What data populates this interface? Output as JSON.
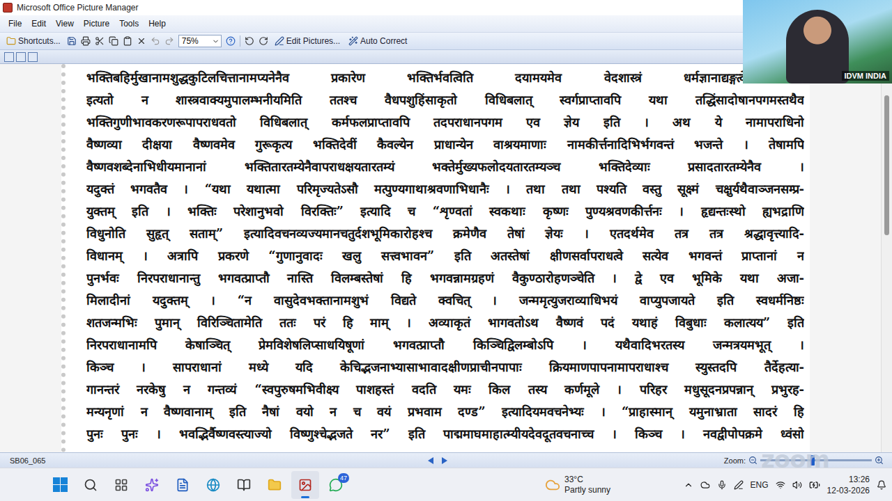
{
  "window": {
    "title": "Microsoft Office Picture Manager"
  },
  "menu": [
    "File",
    "Edit",
    "View",
    "Picture",
    "Tools",
    "Help"
  ],
  "toolbar": {
    "shortcuts": "Shortcuts...",
    "zoom": "75%",
    "edit": "Edit Pictures...",
    "autocorrect": "Auto Correct"
  },
  "document": {
    "lines": [
      "भक्तिबहिर्मुखानामशुद्धकुटिलचित्तानामप्यनेनैव प्रकारेण भक्तिर्भवत्विति दयामयमेव वेदशास्त्रं धर्मज्ञानाद्यङ्गत्वेन भ",
      "इत्यतो न शास्त्रवाक्यमुपालम्भनीयमिति ततश्च वैधपशुहिंसाकृतो विधिबलात् स्वर्गप्राप्तावपि यथा तद्धिंसादोषानपगमस्तथैव",
      "भक्तिगुणीभावकरणरूपापराधवतो विधिबलात् कर्मफलप्राप्तावपि तदपराधानपगम एव ज्ञेय इति । अथ ये नामापराधिनो",
      "वैष्णव्या दीक्षया वैष्णवमेव गुरूकृत्य भक्तिदेवीं कैवल्येन प्राधान्येन वाश्रयमाणाः नामकीर्त्तनादिभिर्भगवन्तं भजन्ते । तेषामपि",
      "वैष्णवशब्देनाभिधीयमानानां भक्तितारतम्येनैवापराधक्षयतारतम्यं भक्तेर्मुख्यफलोदयतारतम्यञ्च भक्तिदेव्याः प्रसादतारतम्येनैव ।",
      "यदुक्तं भगवतैव । “यथा यथात्मा परिमृज्यतेऽसौ मत्पुण्यगाथाश्रवणाभिधानैः । तथा तथा पश्यति वस्तु सूक्ष्मं चक्षुर्यथैवाञ्जनसम्प्र-",
      "युक्तम् इति । भक्तिः परेशानुभवो विरक्तिः” इत्यादि च “शृण्वतां स्वकथाः कृष्णः पुण्यश्रवणकीर्त्तनः । हृद्यन्तःस्थो ह्यभद्राणि",
      "विधुनोति सुहृत् सताम्” इत्यादिवचनव्यज्यमानचतुर्दशभूमिकारोहश्च क्रमेणैव तेषां ज्ञेयः । एतदर्थमेव तत्र तत्र श्रद्धावृत्त्यादि-",
      "विधानम् । अत्रापि प्रकरणे “गुणानुवादः खलु सत्त्वभावन” इति अतस्तेषां क्षीणसर्वापराधत्वे सत्येव भगवन्तं प्राप्तानां न",
      "पुनर्भवः निरपराधानान्तु भगवत्प्राप्तौ नास्ति विलम्बस्तेषां हि भगवन्नामग्रहणं वैकुण्ठारोहणञ्चेति । द्वे एव भूमिके यथा अजा-",
      "मिलादीनां यदुक्तम् । “न वासुदेवभक्तानामशुभं विद्यते क्वचित् । जन्ममृत्युजराव्याधिभयं वाप्युपजायते इति स्वधर्मनिष्ठः",
      "शतजन्मभिः पुमान् विरिञ्चितामेति ततः परं हि माम् । अव्याकृतं भागवतोऽथ वैष्णवं पदं यथाहं विबुधाः कलात्यय” इति",
      "निरपराधानामपि केषाञ्चित् प्रेमविशेषलिप्साधयिषूणां भगवत्प्राप्तौ किञ्चिद्विलम्बोऽपि । यथैवादिभरतस्य जन्मत्रयमभूत् ।",
      "किञ्च । सापराधानां मध्ये यदि केचिद्भजनाभ्यासाभावादक्षीणप्राचीनपापाः क्रियमाणपापनामापराधाश्च स्युस्तदपि तैर्देहत्या-",
      "गानन्तरं नरकेषु न गन्तव्यं “स्वपुरुषमभिवीक्ष्य पाशहस्तं वदति यमः किल तस्य कर्णमूले । परिहर मधुसूदनप्रपन्नान् प्रभुरह-",
      "मन्यनृणां न वैष्णवानाम् इति नैषां वयो न च वयं प्रभवाम दण्ड” इत्यादियमवचनेभ्यः । “प्राहास्मान् यमुनाभ्राता सादरं हि",
      "पुनः पुनः । भवद्भिर्वैष्णवस्त्याज्यो विष्णुश्चेद्भजते नर” इति पाद्ममाघमाहात्म्यीयदेवदूतवचनाच्च । किञ्च । नवद्वीपोपक्रमे ध्वंसो"
    ]
  },
  "scrollbar": {
    "position": 0.08,
    "size": 0.36
  },
  "status_bar": {
    "file": "SB06_065",
    "zoom_label": "Zoom:",
    "zoom_level": 0.45
  },
  "video": {
    "name": "IDVM INDIA"
  },
  "watermark": "zoom",
  "taskbar": {
    "apps": [
      {
        "name": "search",
        "selected": false,
        "badge": ""
      },
      {
        "name": "task-view",
        "selected": false,
        "badge": ""
      },
      {
        "name": "copilot",
        "selected": false,
        "badge": ""
      },
      {
        "name": "word",
        "selected": false,
        "badge": ""
      },
      {
        "name": "edge",
        "selected": false,
        "badge": ""
      },
      {
        "name": "reader",
        "selected": false,
        "badge": ""
      },
      {
        "name": "explorer",
        "selected": false,
        "badge": ""
      },
      {
        "name": "picture-manager",
        "selected": true,
        "badge": ""
      },
      {
        "name": "whatsapp",
        "selected": false,
        "badge": "47"
      }
    ],
    "weather_temp": "33°C",
    "weather_text": "Partly sunny",
    "lang": "ENG",
    "time": "13:26",
    "date": "12-03-2026"
  }
}
